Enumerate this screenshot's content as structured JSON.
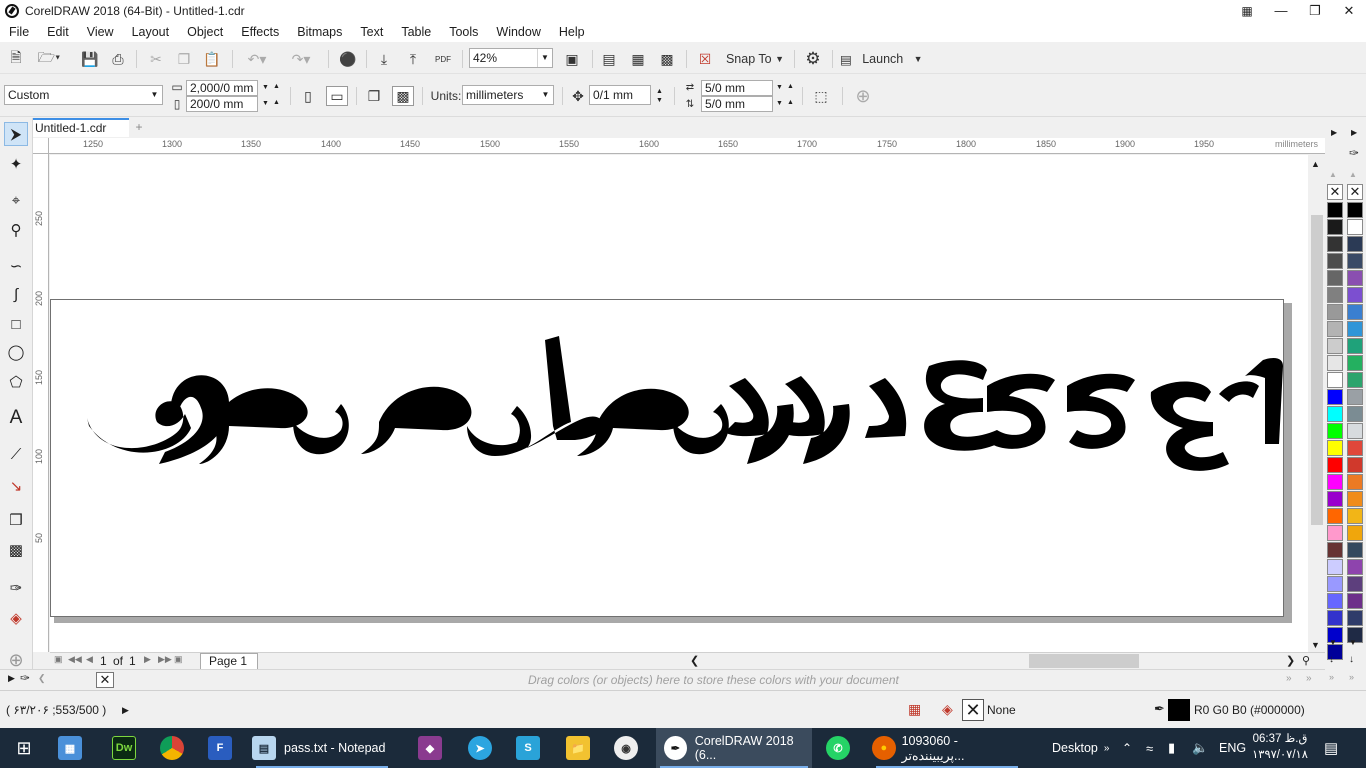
{
  "window": {
    "title": "CorelDRAW 2018 (64-Bit) - Untitled-1.cdr"
  },
  "menu": [
    "File",
    "Edit",
    "View",
    "Layout",
    "Object",
    "Effects",
    "Bitmaps",
    "Text",
    "Table",
    "Tools",
    "Window",
    "Help"
  ],
  "toolbar": {
    "zoom_value": "42%",
    "snap_to_label": "Snap To",
    "launch_label": "Launch",
    "pdf_label": "PDF"
  },
  "property_bar": {
    "page_size_preset": "Custom",
    "page_width": "2,000/0 mm",
    "page_height": "200/0 mm",
    "units_label": "Units:",
    "units_value": "millimeters",
    "nudge_distance": "0/1 mm",
    "dup_x": "5/0 mm",
    "dup_y": "5/0 mm"
  },
  "document": {
    "tab_name": "Untitled-1.cdr"
  },
  "ruler": {
    "h_labels": [
      "1250",
      "1300",
      "1350",
      "1400",
      "1450",
      "1500",
      "1550",
      "1600",
      "1650",
      "1700",
      "1750",
      "1800",
      "1850",
      "1900",
      "1950"
    ],
    "h_unit": "millimeters",
    "v_labels": [
      "250",
      "200",
      "150",
      "100",
      "50"
    ]
  },
  "page_nav": {
    "current_page": "1",
    "of_label": "of",
    "total_pages": "1",
    "page_tab": "Page 1"
  },
  "color_tray": {
    "hint": "Drag colors (or objects) here to store these colors with your document"
  },
  "status": {
    "cursor_coords": "( ۶۳/۲۰۶ ;553/500 )",
    "fill_label": "None",
    "outline_color": "R0 G0 B0 (#000000)"
  },
  "colors": {
    "accent": "#3d8ee5",
    "taskbar": "#1b2a3a",
    "palette_main": [
      "#000000",
      "#1a1a1a",
      "#333333",
      "#4d4d4d",
      "#666666",
      "#808080",
      "#999999",
      "#b3b3b3",
      "#cccccc",
      "#e6e6e6",
      "#ffffff",
      "#0000ff",
      "#00ffff",
      "#00ff00",
      "#ffff00",
      "#ff0000",
      "#ff00ff",
      "#9900cc",
      "#ff6600",
      "#ff99cc",
      "#663333",
      "#ccccff",
      "#9999ff",
      "#6666ff",
      "#3333cc",
      "#0000cc",
      "#000099"
    ],
    "palette_second": [
      "#000000",
      "#ffffff",
      "#2b3a55",
      "#3a4a66",
      "#8a4fb0",
      "#7c4fd0",
      "#3a7fd0",
      "#2f95d8",
      "#1fa27a",
      "#24b060",
      "#2ca46d",
      "#9aa0a5",
      "#7b8c93",
      "#d7dbde",
      "#e0473a",
      "#d0392c",
      "#ec7a24",
      "#f08c1a",
      "#f2b517",
      "#f0a60c",
      "#34495e",
      "#8e44ad",
      "#5d3f7d",
      "#6d2f8a",
      "#2f3c6a",
      "#1f2a45"
    ]
  },
  "taskbar": {
    "notepad_label": "pass.txt - Notepad",
    "corel_label": "CorelDRAW 2018 (6...",
    "firefox_label": "1093060 - پریبینندەتر...",
    "desktop_label": "Desktop",
    "lang": "ENG",
    "time": "06:37 ق.ظ",
    "date": "۱۳۹۷/۰۷/۱۸",
    "dw_label": "Dw"
  }
}
